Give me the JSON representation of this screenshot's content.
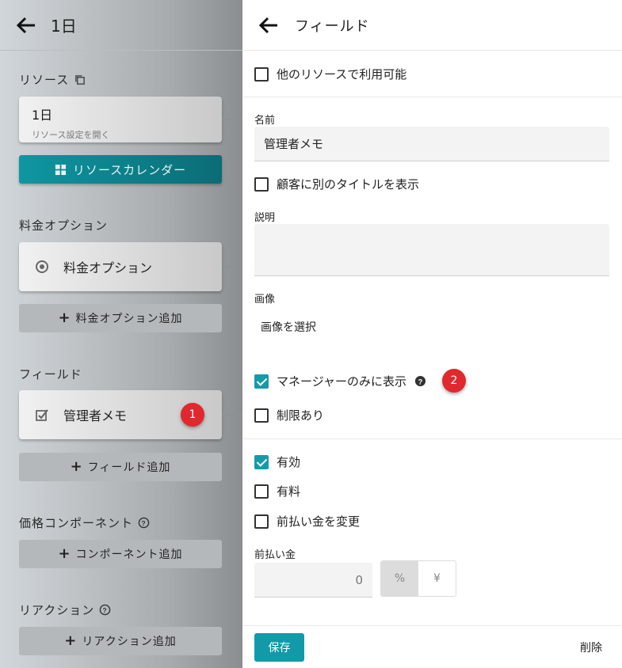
{
  "left": {
    "title": "1日",
    "resource_label": "リソース",
    "resource_card_title": "1日",
    "resource_card_sub": "リソース設定を開く",
    "calendar_button": "リソースカレンダー",
    "price_options_label": "料金オプション",
    "price_option_item": "料金オプション",
    "add_price_option": "料金オプション追加",
    "fields_label": "フィールド",
    "field_item": "管理者メモ",
    "field_badge": "1",
    "add_field": "フィールド追加",
    "price_component_label": "価格コンポーネント",
    "add_component": "コンポーネント追加",
    "reaction_label": "リアクション",
    "add_reaction": "リアクション追加"
  },
  "right": {
    "title": "フィールド",
    "other_resources": "他のリソースで利用可能",
    "name_label": "名前",
    "name_value": "管理者メモ",
    "customer_title": "顧客に別のタイトルを表示",
    "description_label": "説明",
    "image_label": "画像",
    "image_select": "画像を選択",
    "manager_only": "マネージャーのみに表示",
    "manager_badge": "2",
    "restricted": "制限あり",
    "enabled": "有効",
    "paid": "有料",
    "change_deposit": "前払い金を変更",
    "deposit_label": "前払い金",
    "deposit_value": "0",
    "unit_percent": "%",
    "unit_yen": "¥",
    "save": "保存",
    "delete": "削除"
  }
}
